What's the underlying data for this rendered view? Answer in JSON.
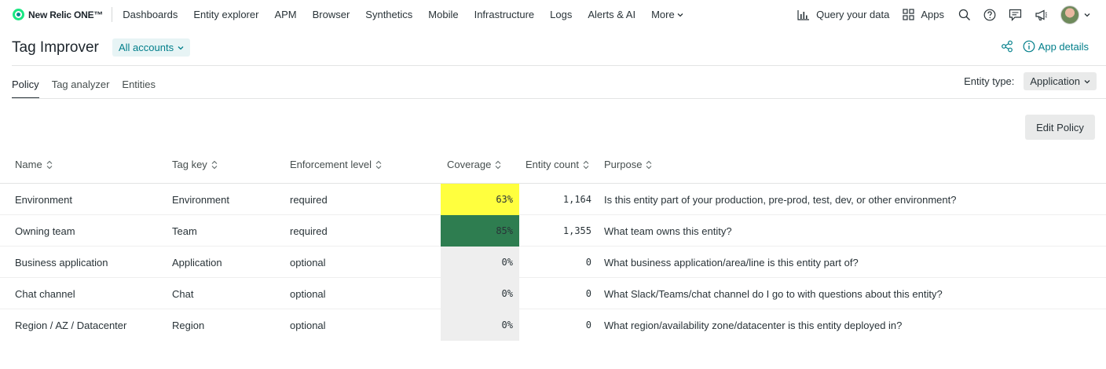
{
  "brand": {
    "logo_text": "New Relic ONE™"
  },
  "topnav": {
    "items": [
      "Dashboards",
      "Entity explorer",
      "APM",
      "Browser",
      "Synthetics",
      "Mobile",
      "Infrastructure",
      "Logs",
      "Alerts & AI",
      "More"
    ],
    "query_label": "Query your data",
    "apps_label": "Apps",
    "icons": [
      "chart-icon",
      "apps-grid-icon",
      "search-icon",
      "help-icon",
      "feedback-icon",
      "announcement-icon",
      "avatar",
      "chevron-down-icon"
    ]
  },
  "header": {
    "title": "Tag Improver",
    "accounts_label": "All accounts",
    "app_details_label": "App details"
  },
  "tabs": [
    {
      "label": "Policy",
      "active": true
    },
    {
      "label": "Tag analyzer",
      "active": false
    },
    {
      "label": "Entities",
      "active": false
    }
  ],
  "entity_type": {
    "label": "Entity type:",
    "value": "Application"
  },
  "edit_policy_label": "Edit Policy",
  "table": {
    "columns": [
      "Name",
      "Tag key",
      "Enforcement level",
      "Coverage",
      "Entity count",
      "Purpose"
    ],
    "rows": [
      {
        "name": "Environment",
        "tag_key": "Environment",
        "enforcement": "required",
        "coverage": "63%",
        "entity_count": "1,164",
        "purpose": "Is this entity part of your production, pre-prod, test, dev, or other environment?",
        "coverage_color": "#ffff3e"
      },
      {
        "name": "Owning team",
        "tag_key": "Team",
        "enforcement": "required",
        "coverage": "85%",
        "entity_count": "1,355",
        "purpose": "What team owns this entity?",
        "coverage_color": "#2e7d50"
      },
      {
        "name": "Business application",
        "tag_key": "Application",
        "enforcement": "optional",
        "coverage": "0%",
        "entity_count": "0",
        "purpose": "What business application/area/line is this entity part of?",
        "coverage_color": "#eeeeee"
      },
      {
        "name": "Chat channel",
        "tag_key": "Chat",
        "enforcement": "optional",
        "coverage": "0%",
        "entity_count": "0",
        "purpose": "What Slack/Teams/chat channel do I go to with questions about this entity?",
        "coverage_color": "#eeeeee"
      },
      {
        "name": "Region / AZ / Datacenter",
        "tag_key": "Region",
        "enforcement": "optional",
        "coverage": "0%",
        "entity_count": "0",
        "purpose": "What region/availability zone/datacenter is this entity deployed in?",
        "coverage_color": "#eeeeee"
      }
    ]
  },
  "colors": {
    "accent": "#007e8a",
    "brand_green": "#1ce783"
  }
}
